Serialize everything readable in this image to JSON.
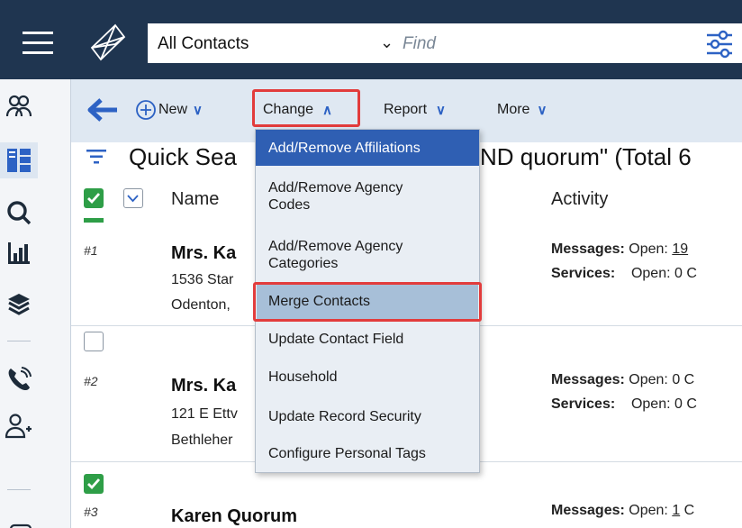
{
  "header": {
    "search_scope": "All Contacts",
    "search_placeholder": "Find"
  },
  "toolbar": {
    "new_label": "New",
    "change_label": "Change",
    "report_label": "Report",
    "more_label": "More"
  },
  "list": {
    "title": "Quick Sea",
    "title_tail": "ND quorum\" (Total 6",
    "columns": {
      "name": "Name",
      "activity": "Activity"
    },
    "rows": [
      {
        "number": "#1",
        "name": "Mrs. Ka",
        "address1": "1536 Star",
        "address2": "Odenton,",
        "messages_label": "Messages:",
        "messages_value_prefix": "Open: ",
        "messages_link": "19",
        "services_label": "Services:",
        "services_value": "Open: 0 C"
      },
      {
        "number": "#2",
        "name": "Mrs. Ka",
        "address1": "121 E Ettv",
        "address2": "Bethleher",
        "messages_label": "Messages:",
        "messages_value": "Open: 0 C",
        "services_label": "Services:",
        "services_value": "Open: 0 C"
      },
      {
        "number": "#3",
        "name": "Karen Quorum",
        "messages_label": "Messages:",
        "messages_value_prefix": "Open: ",
        "messages_link": "1",
        "messages_value_suffix": " C"
      }
    ]
  },
  "change_menu": {
    "items": [
      "Add/Remove Affiliations",
      "Add/Remove Agency Codes",
      "Add/Remove Agency Categories",
      "Merge Contacts",
      "Update Contact Field",
      "Household",
      "Update Record Security",
      "Configure Personal Tags"
    ],
    "multi_line": {
      "agency_codes_l1": "Add/Remove Agency",
      "agency_codes_l2": "Codes",
      "agency_cat_l1": "Add/Remove Agency",
      "agency_cat_l2": "Categories"
    }
  },
  "icons": {
    "rail": [
      "hamburger-menu-icon",
      "contacts-group-icon",
      "dashboard-icon",
      "search-icon",
      "reports-chart-icon",
      "layers-icon",
      "phone-call-icon",
      "add-person-icon"
    ],
    "header": [
      "app-logo-icon",
      "filter-sliders-icon"
    ],
    "toolbar": [
      "back-arrow-icon",
      "plus-circle-icon"
    ]
  },
  "colors": {
    "header_bg": "#1f3550",
    "toolbar_bg": "#dfe8f2",
    "menu_active": "#2f5fb3",
    "merge_highlight": "#a7bfd8",
    "annotation_red": "#e23c3c",
    "checkbox_green": "#2e9e47",
    "accent_blue": "#2d62c4"
  }
}
